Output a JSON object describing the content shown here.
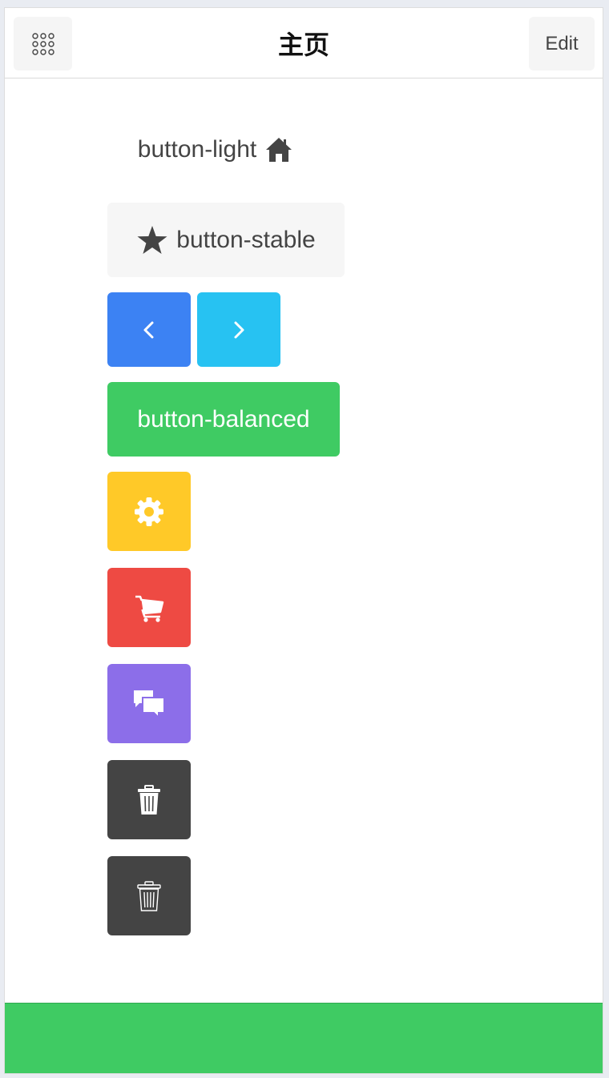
{
  "header": {
    "title": "主页",
    "edit_label": "Edit",
    "menu_icon": "grid-dots-icon"
  },
  "buttons": {
    "light": {
      "label": "button-light",
      "icon": "home-icon"
    },
    "stable": {
      "label": "button-stable",
      "icon": "star-icon"
    },
    "prev": {
      "icon": "chevron-left-icon"
    },
    "next": {
      "icon": "chevron-right-icon"
    },
    "balanced": {
      "label": "button-balanced"
    },
    "energized": {
      "icon": "gear-icon"
    },
    "assertive": {
      "icon": "cart-icon"
    },
    "royal": {
      "icon": "chat-bubbles-icon"
    },
    "dark_filled": {
      "icon": "trash-filled-icon"
    },
    "dark_outline": {
      "icon": "trash-outline-icon"
    }
  },
  "colors": {
    "positive": "#3c82f3",
    "calm": "#27c2f2",
    "balanced": "#3fcb63",
    "energized": "#ffc928",
    "assertive": "#ee4a43",
    "royal": "#8c6ee9",
    "dark": "#444444",
    "stable": "#f6f6f6"
  }
}
